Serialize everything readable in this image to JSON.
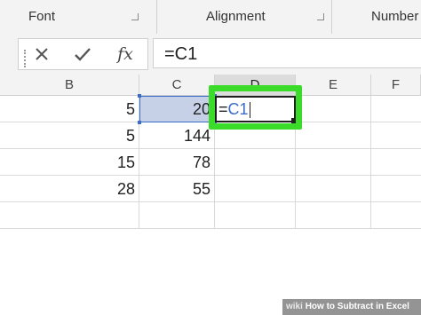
{
  "ribbon": {
    "groups": [
      "Font",
      "Alignment",
      "Number"
    ]
  },
  "formula_bar": {
    "cancel_icon": "close-icon",
    "enter_icon": "checkmark-icon",
    "function_label": "fx",
    "value": "=C1"
  },
  "columns": [
    "B",
    "C",
    "D",
    "E",
    "F"
  ],
  "rows": [
    {
      "B": "5",
      "C": "20"
    },
    {
      "B": "5",
      "C": "144"
    },
    {
      "B": "15",
      "C": "78"
    },
    {
      "B": "28",
      "C": "55"
    }
  ],
  "active_cell": {
    "ref_text": "=",
    "ref_link": "C1"
  },
  "colors": {
    "highlight": "#3bdb2a",
    "reference": "#3b6cc7"
  },
  "watermark": {
    "brand": "wiki",
    "text": "How to Subtract in Excel"
  }
}
